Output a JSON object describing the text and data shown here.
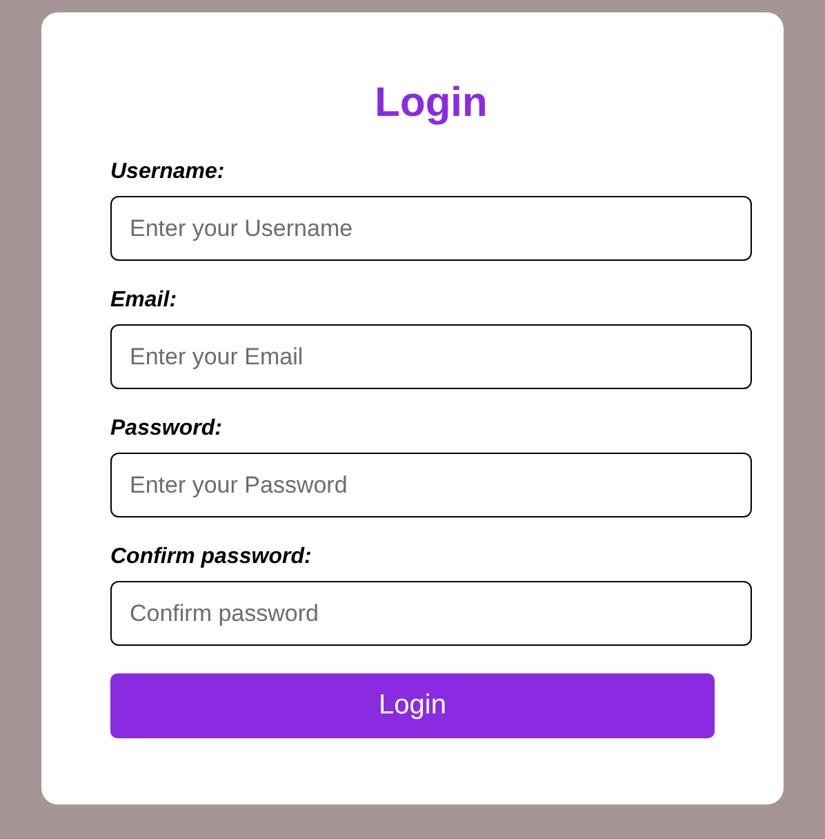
{
  "title": "Login",
  "fields": [
    {
      "label": "Username:",
      "placeholder": "Enter your Username"
    },
    {
      "label": "Email:",
      "placeholder": "Enter your Email"
    },
    {
      "label": "Password:",
      "placeholder": "Enter your Password"
    },
    {
      "label": "Confirm password:",
      "placeholder": "Confirm password"
    }
  ],
  "button": "Login"
}
